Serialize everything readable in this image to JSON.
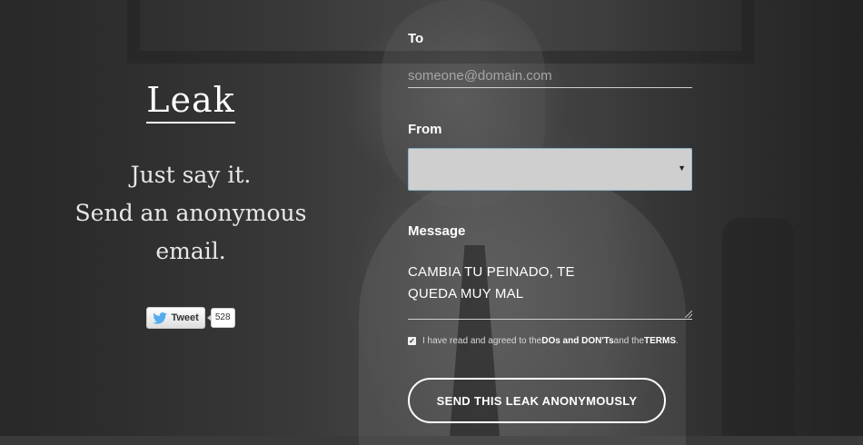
{
  "brand": {
    "logo": "Leak",
    "tagline_line1": "Just say it.",
    "tagline_line2": "Send an anonymous",
    "tagline_line3": "email."
  },
  "tweet": {
    "label": "Tweet",
    "count": "528"
  },
  "form": {
    "to_label": "To",
    "to_placeholder": "someone@domain.com",
    "to_value": "",
    "from_label": "From",
    "from_selected": "",
    "message_label": "Message",
    "message_line1": "CAMBIA TU PEINADO, TE",
    "message_line2": "QUEDA MUY MAL",
    "terms_checked": true,
    "terms_prefix": "I have read and agreed to the ",
    "terms_link1": "DOs and DON'Ts",
    "terms_middle": " and the ",
    "terms_link2": "TERMS",
    "terms_suffix": ".",
    "send_label": "SEND THIS LEAK ANONYMOUSLY"
  },
  "icons": {
    "twitter_bird": "twitter-bird-icon",
    "select_caret": "caret-down-icon",
    "check": "checkmark-icon"
  },
  "colors": {
    "twitter_blue": "#55acee",
    "select_border": "#8fb3c9"
  }
}
